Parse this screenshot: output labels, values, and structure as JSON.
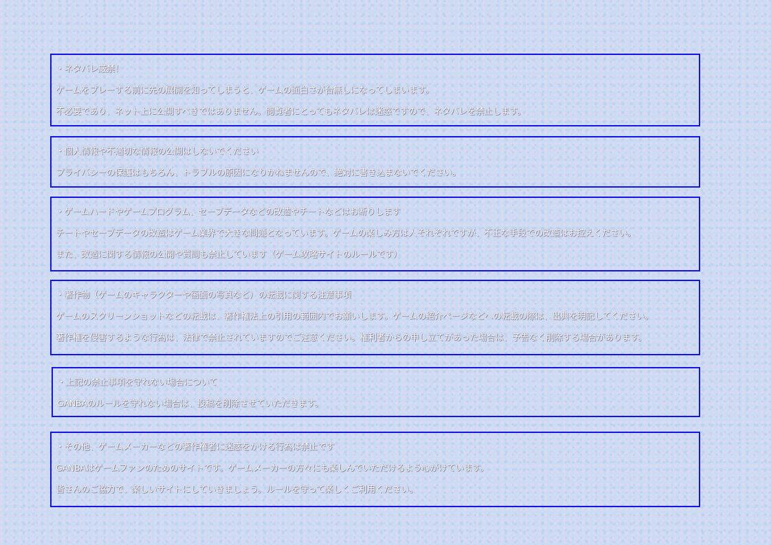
{
  "panels": [
    {
      "lines": [
        "・ネタバレ厳禁！",
        "ゲームをプレーする前に先の展開を知ってしまうと、ゲームの面白さが台無しになってしまいます。",
        "不必要であり、ネット上に公開すべきではありません。閲覧者にとってもネタバレは迷惑ですので、ネタバレを禁止します。"
      ]
    },
    {
      "lines": [
        "・個人情報や不適切な情報の公開はしないでください",
        "プライバシーの保護はもちろん、トラブルの原因になりかねませんので、絶対に書き込まないでください。"
      ]
    },
    {
      "lines": [
        "・ゲームハードやゲームプログラム、セーブデータなどの改造やチートなどはお断りします",
        "チートやセーブデータの改造はゲーム業界で大きな問題となっています。ゲームの楽しみ方は人それぞれですが、不正な手段での改造はお控えください。",
        "また、改造に関する情報の公開や質問も禁止しています（ゲーム攻略サイトのルールです）"
      ]
    },
    {
      "lines": [
        "・著作物（ゲームのキャラクターや画面の写真など）の転載に関する注意事項",
        "ゲームのスクリーンショットなどの転載は、著作権法上の引用の範囲内でお願いします。ゲームの紹介ページなどへの転載の際は、出典を明記してください。",
        "著作権を侵害するような行為は、法律で禁止されていますのでご注意ください。権利者からの申し立てがあった場合は、予告なく削除する場合があります。"
      ]
    },
    {
      "lines": [
        "・上記の禁止事項を守れない場合について",
        "GANBAのルールを守れない場合は、投稿を削除させていただきます。"
      ]
    },
    {
      "lines": [
        "・その他、ゲームメーカーなどの著作権者に迷惑をかける行為は禁止です",
        "GANBAはゲームファンのためのサイトです。ゲームメーカーの方々にも楽しんでいただけるよう心がけています。",
        "皆さんのご協力で、楽しいサイトにしていきましょう。ルールを守って楽しくご利用ください。"
      ]
    }
  ]
}
